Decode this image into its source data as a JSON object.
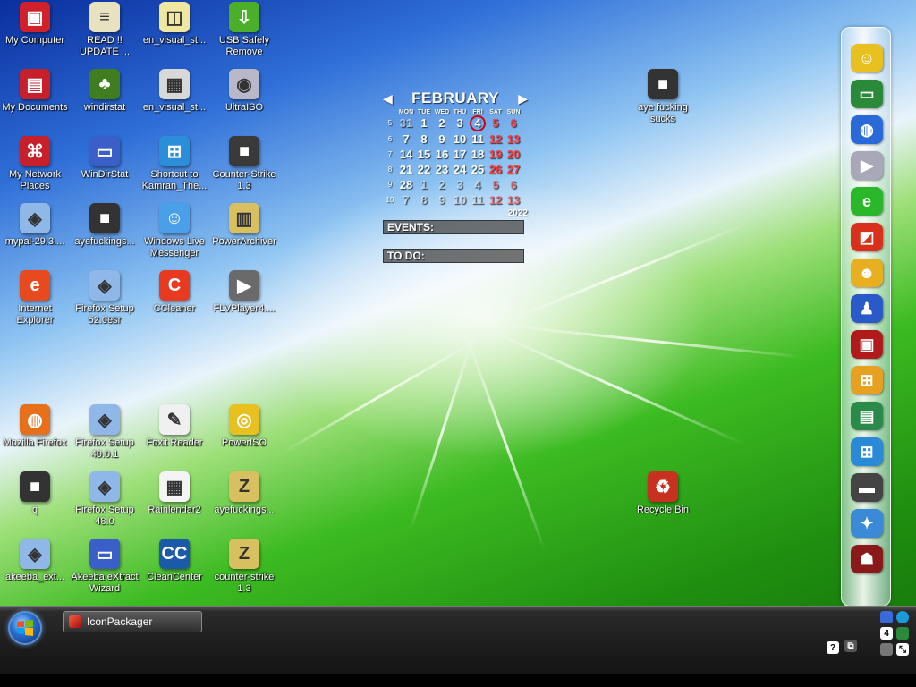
{
  "desktop_icons": [
    {
      "label": "My Computer",
      "icon": "computer-icon",
      "color": "#d0202a"
    },
    {
      "label": "READ !! UPDATE ...",
      "icon": "text-document-icon",
      "color": "#e8e2c0"
    },
    {
      "label": "en_visual_st...",
      "icon": "iso-file-icon",
      "color": "#efe6a0"
    },
    {
      "label": "USB Safely Remove",
      "icon": "usb-icon",
      "color": "#4caf2a"
    },
    {
      "label": "My Documents",
      "icon": "documents-folder-icon",
      "color": "#c8202a"
    },
    {
      "label": "windirstat",
      "icon": "tree-icon",
      "color": "#3f7d20"
    },
    {
      "label": "en_visual_st...",
      "icon": "document-icon",
      "color": "#d8d8d8"
    },
    {
      "label": "UltraISO",
      "icon": "disc-icon",
      "color": "#b8b8c8"
    },
    {
      "label": "My Network Places",
      "icon": "network-icon",
      "color": "#c8202a"
    },
    {
      "label": "WinDirStat",
      "icon": "window-icon",
      "color": "#3a5fc8"
    },
    {
      "label": "Shortcut to Kamran_The...",
      "icon": "windows-logo-icon",
      "color": "#2a8fd8"
    },
    {
      "label": "Counter-Strike 1.3",
      "icon": "game-folder-icon",
      "color": "#3a3a3a"
    },
    {
      "label": "mypal-29.3....",
      "icon": "installer-icon",
      "color": "#8fb8e8"
    },
    {
      "label": "ayefuckings...",
      "icon": "archive-icon",
      "color": "#333333"
    },
    {
      "label": "Windows Live Messenger",
      "icon": "messenger-icon",
      "color": "#4aa0e8"
    },
    {
      "label": "PowerArchiver",
      "icon": "archive-box-icon",
      "color": "#d8c060"
    },
    {
      "label": "Internet Explorer",
      "icon": "ie-icon",
      "color": "#e84a20"
    },
    {
      "label": "Firefox Setup 52.0esr",
      "icon": "installer-icon",
      "color": "#8fb8e8"
    },
    {
      "label": "CCleaner",
      "icon": "ccleaner-icon",
      "color": "#e83a20"
    },
    {
      "label": "FLVPlayer4....",
      "icon": "film-icon",
      "color": "#6a6a6a"
    },
    {
      "label": "Mozilla Firefox",
      "icon": "firefox-icon",
      "color": "#e8701a"
    },
    {
      "label": "Firefox Setup 49.0.1",
      "icon": "installer-icon",
      "color": "#8fb8e8"
    },
    {
      "label": "Foxit Reader",
      "icon": "foxit-icon",
      "color": "#f0f0f0"
    },
    {
      "label": "PowerISO",
      "icon": "poweriso-icon",
      "color": "#e8c020"
    },
    {
      "label": "q",
      "icon": "archive-icon",
      "color": "#333333"
    },
    {
      "label": "Firefox Setup 48.0",
      "icon": "installer-icon",
      "color": "#8fb8e8"
    },
    {
      "label": "Rainlendar2",
      "icon": "calendar-icon",
      "color": "#f4f4f4"
    },
    {
      "label": "ayefuckings...",
      "icon": "zip-icon",
      "color": "#d8c060"
    },
    {
      "label": "akeeba_ext...",
      "icon": "installer-icon",
      "color": "#8fb8e8"
    },
    {
      "label": "Akeeba eXtract Wizard",
      "icon": "window-icon",
      "color": "#3a5fc8"
    },
    {
      "label": "CleanCenter",
      "icon": "cleancenter-icon",
      "color": "#1a5aa8"
    },
    {
      "label": "counter-strike 1.3",
      "icon": "zip-icon",
      "color": "#d8c060"
    },
    {
      "label": "aye fucking sucks",
      "icon": "archive-icon",
      "color": "#333333"
    },
    {
      "label": "Recycle Bin",
      "icon": "recycle-bin-icon",
      "color": "#c83020"
    }
  ],
  "calendar": {
    "month": "FEBRUARY",
    "year": "2022",
    "prev_arrow": "◀",
    "next_arrow": "▶",
    "weekdays": [
      "MON",
      "TUE",
      "WED",
      "THU",
      "FRI",
      "SAT",
      "SUN"
    ],
    "weeks": [
      {
        "wk": "5",
        "days": [
          "31",
          "1",
          "2",
          "3",
          "4",
          "5",
          "6"
        ]
      },
      {
        "wk": "6",
        "days": [
          "7",
          "8",
          "9",
          "10",
          "11",
          "12",
          "13"
        ]
      },
      {
        "wk": "7",
        "days": [
          "14",
          "15",
          "16",
          "17",
          "18",
          "19",
          "20"
        ]
      },
      {
        "wk": "8",
        "days": [
          "21",
          "22",
          "23",
          "24",
          "25",
          "26",
          "27"
        ]
      },
      {
        "wk": "9",
        "days": [
          "28",
          "1",
          "2",
          "3",
          "4",
          "5",
          "6"
        ]
      },
      {
        "wk": "10",
        "days": [
          "7",
          "8",
          "9",
          "10",
          "11",
          "12",
          "13"
        ]
      }
    ],
    "today": "4",
    "events_label": "EVENTS:",
    "todo_label": "TO DO:"
  },
  "dock_items": [
    {
      "icon": "smiley-icon",
      "color": "#e8c020"
    },
    {
      "icon": "monitor-icon",
      "color": "#2a8a3a"
    },
    {
      "icon": "globe-icon",
      "color": "#2a6ad8"
    },
    {
      "icon": "media-player-icon",
      "color": "#a8a8b8"
    },
    {
      "icon": "ie-green-icon",
      "color": "#2ab82a"
    },
    {
      "icon": "media-icon",
      "color": "#d8301a"
    },
    {
      "icon": "messenger-smiley-icon",
      "color": "#e8b020"
    },
    {
      "icon": "users-icon",
      "color": "#2a5ac8"
    },
    {
      "icon": "shield-icon",
      "color": "#b01a1a"
    },
    {
      "icon": "windows-logo-icon",
      "color": "#e8a020"
    },
    {
      "icon": "books-icon",
      "color": "#2a8a4a"
    },
    {
      "icon": "windows-flag-icon",
      "color": "#2a8ad8"
    },
    {
      "icon": "laptop-icon",
      "color": "#444444"
    },
    {
      "icon": "tools-icon",
      "color": "#3a8ad8"
    },
    {
      "icon": "character-icon",
      "color": "#8a1a1a"
    }
  ],
  "taskbar": {
    "start_icon": "windows-orb-icon",
    "task_button_label": "IconPackager",
    "tray_day": "4"
  }
}
